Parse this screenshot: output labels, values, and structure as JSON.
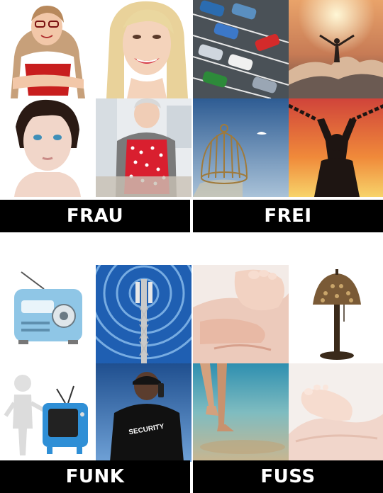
{
  "puzzles": [
    {
      "answer": "FRAU",
      "images": [
        "smiling-woman-glasses-icon",
        "blonde-woman-smile-icon",
        "woman-face-portrait-icon",
        "grandmother-kitchen-icon"
      ]
    },
    {
      "answer": "FREI",
      "images": [
        "parked-cars-aerial-icon",
        "person-arms-raised-mountain-icon",
        "open-birdcage-icon",
        "breaking-chains-icon"
      ]
    },
    {
      "answer": "FUNK",
      "images": [
        "retro-radio-icon",
        "radio-tower-waves-icon",
        "figure-with-tv-icon",
        "security-guard-radio-icon"
      ]
    },
    {
      "answer": "FUSS",
      "images": [
        "foot-massage-icon",
        "ornate-table-lamp-icon",
        "walking-beach-feet-icon",
        "baby-foot-hands-icon"
      ]
    }
  ],
  "colors": {
    "label_bg": "#000000",
    "label_text": "#ffffff"
  }
}
